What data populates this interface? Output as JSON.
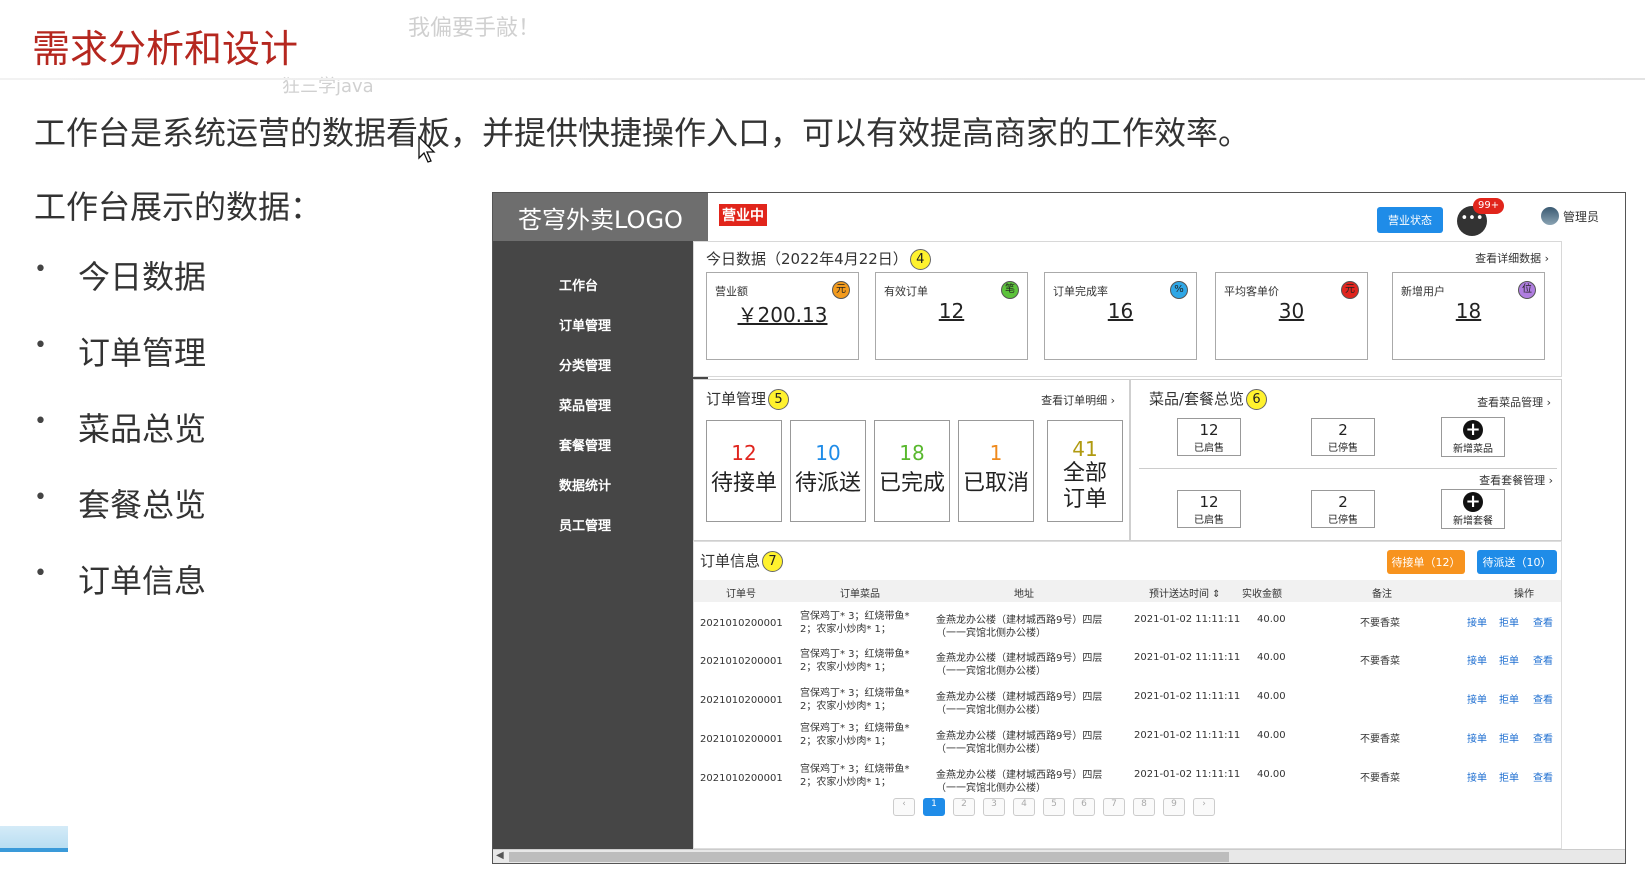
{
  "slide": {
    "title": "需求分析和设计",
    "intro": "工作台是系统运营的数据看板，并提供快捷操作入口，可以有效提高商家的工作效率。",
    "subhead": "工作台展示的数据：",
    "bullet_mark": "•",
    "bullets": [
      "今日数据",
      "订单管理",
      "菜品总览",
      "套餐总览",
      "订单信息"
    ],
    "danmaku": [
      "我偏要手敲！",
      "狂三学java"
    ]
  },
  "mockup": {
    "logo": "苍穹外卖LOGO",
    "nav": [
      "工作台",
      "订单管理",
      "分类管理",
      "菜品管理",
      "套餐管理",
      "数据统计",
      "员工管理"
    ],
    "top_status": "营业中",
    "status_button": "营业状态",
    "msg_badge": "99+",
    "admin": "管理员",
    "today": {
      "title": "今日数据（2022年4月22日）",
      "num": "4",
      "link": "查看详细数据 ›",
      "cards": [
        {
          "label": "营业额",
          "value": "￥200.13",
          "icon": "元",
          "color": "#f39b1d"
        },
        {
          "label": "有效订单",
          "value": "12",
          "icon": "笔",
          "color": "#5cc23b"
        },
        {
          "label": "订单完成率",
          "value": "16",
          "icon": "%",
          "color": "#2fa7e6"
        },
        {
          "label": "平均客单价",
          "value": "30",
          "icon": "元",
          "color": "#e0251e"
        },
        {
          "label": "新增用户",
          "value": "18",
          "icon": "位",
          "color": "#b07ee0"
        }
      ]
    },
    "orders": {
      "title": "订单管理",
      "num": "5",
      "link": "查看订单明细 ›",
      "boxes": [
        {
          "n": "12",
          "t": "待接单",
          "color": "#e0251e"
        },
        {
          "n": "10",
          "t": "待派送",
          "color": "#1f8ce8"
        },
        {
          "n": "18",
          "t": "已完成",
          "color": "#58b82d"
        },
        {
          "n": "1",
          "t": "已取消",
          "color": "#ef8a1d"
        },
        {
          "n": "41",
          "t": "全部",
          "t2": "订单",
          "color": "#b09a10"
        }
      ]
    },
    "overview": {
      "title": "菜品/套餐总览",
      "num": "6",
      "dish_link": "查看菜品管理 ›",
      "set_link": "查看套餐管理 ›",
      "dish": {
        "on": "12",
        "on_label": "已启售",
        "off": "2",
        "off_label": "已停售",
        "add": "新增菜品"
      },
      "set": {
        "on": "12",
        "on_label": "已启售",
        "off": "2",
        "off_label": "已停售",
        "add": "新增套餐"
      }
    },
    "info": {
      "title": "订单信息",
      "num": "7",
      "btn_wait": "待接单（12）",
      "btn_deliver": "待派送（10）",
      "headers": [
        "订单号",
        "订单菜品",
        "地址",
        "预计送达时间 ⇕",
        "实收金额",
        "备注",
        "操作"
      ],
      "rows": [
        {
          "id": "2021010200001",
          "dish1": "宫保鸡丁* 3；红烧带鱼*",
          "dish2": "2；农家小炒肉* 1；",
          "addr1": "金燕龙办公楼（建材城西路9号）四层",
          "addr2": "（一一宾馆北侧办公楼）",
          "time": "2021-01-02 11:11:11",
          "amount": "40.00",
          "note": "不要香菜",
          "a1": "接单",
          "a2": "拒单",
          "a3": "查看"
        },
        {
          "id": "2021010200001",
          "dish1": "宫保鸡丁* 3；红烧带鱼*",
          "dish2": "2；农家小炒肉* 1；",
          "addr1": "金燕龙办公楼（建材城西路9号）四层",
          "addr2": "（一一宾馆北侧办公楼）",
          "time": "2021-01-02 11:11:11",
          "amount": "40.00",
          "note": "不要香菜",
          "a1": "接单",
          "a2": "拒单",
          "a3": "查看"
        },
        {
          "id": "2021010200001",
          "dish1": "宫保鸡丁* 3；红烧带鱼*",
          "dish2": "2；农家小炒肉* 1；",
          "addr1": "金燕龙办公楼（建材城西路9号）四层",
          "addr2": "（一一宾馆北侧办公楼）",
          "time": "2021-01-02 11:11:11",
          "amount": "40.00",
          "note": "",
          "a1": "接单",
          "a2": "拒单",
          "a3": "查看"
        },
        {
          "id": "2021010200001",
          "dish1": "宫保鸡丁* 3；红烧带鱼*",
          "dish2": "2；农家小炒肉* 1；",
          "addr1": "金燕龙办公楼（建材城西路9号）四层",
          "addr2": "（一一宾馆北侧办公楼）",
          "time": "2021-01-02 11:11:11",
          "amount": "40.00",
          "note": "不要香菜",
          "a1": "接单",
          "a2": "拒单",
          "a3": "查看"
        },
        {
          "id": "2021010200001",
          "dish1": "宫保鸡丁* 3；红烧带鱼*",
          "dish2": "2；农家小炒肉* 1；",
          "addr1": "金燕龙办公楼（建材城西路9号）四层",
          "addr2": "（一一宾馆北侧办公楼）",
          "time": "2021-01-02 11:11:11",
          "amount": "40.00",
          "note": "不要香菜",
          "a1": "接单",
          "a2": "拒单",
          "a3": "查看"
        }
      ],
      "pager": [
        "‹",
        "1",
        "2",
        "3",
        "4",
        "5",
        "6",
        "7",
        "8",
        "9",
        "›"
      ]
    }
  }
}
